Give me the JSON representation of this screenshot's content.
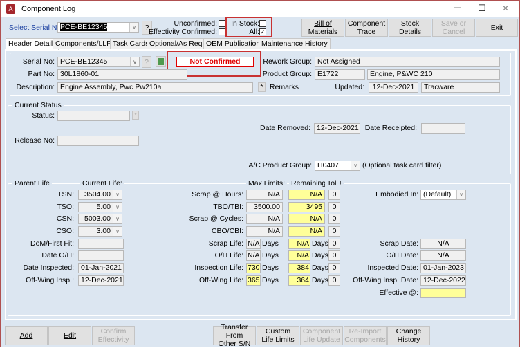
{
  "window": {
    "title": "Component Log",
    "minimize": "—",
    "maximize": "☐",
    "close": "✕"
  },
  "toolbar": {
    "select_serial_label": "Select Serial No:",
    "select_serial_value": "PCE-BE12345",
    "help": "?",
    "unconfirmed_label": "Unconfirmed:",
    "unconfirmed_checked": false,
    "effectivity_label": "Effectivity Confirmed:",
    "effectivity_checked": false,
    "in_stock_label": "In Stock:",
    "in_stock_checked": false,
    "all_label": "All:",
    "all_checked": true,
    "all_mark": "✓",
    "buttons": [
      {
        "l1": "Bill of",
        "l2": "Materials",
        "enabled": true
      },
      {
        "l1": "Component",
        "l2": "Trace",
        "enabled": true
      },
      {
        "l1": "Stock",
        "l2": "Details",
        "enabled": true
      },
      {
        "l1": "Save or",
        "l2": "Cancel",
        "enabled": false
      },
      {
        "l1": "Exit",
        "l2": "",
        "enabled": true
      }
    ]
  },
  "tabs": [
    "Header Details",
    "Components/LLP's",
    "Task Cards",
    "Optional/As Req'd",
    "OEM Publications",
    "Maintenance History"
  ],
  "header": {
    "serial_label": "Serial No:",
    "serial_value": "PCE-BE12345",
    "help": "?",
    "status_badge": "Not Confirmed",
    "part_label": "Part No:",
    "part_value": "30L1860-01",
    "desc_label": "Description:",
    "desc_value": "Engine Assembly, Pwc Pw210a",
    "remarks_btn": "*",
    "remarks_label": "Remarks",
    "rework_label": "Rework Group:",
    "rework_value": "Not Assigned",
    "product_label": "Product Group:",
    "product_code": "E1722",
    "product_name": "Engine, P&WC 210",
    "updated_label": "Updated:",
    "updated_date": "12-Dec-2021",
    "updated_by": "Tracware"
  },
  "status": {
    "legend": "Current Status",
    "status_label": "Status:",
    "status_value": "",
    "status_btn": "*",
    "date_removed_label": "Date Removed:",
    "date_removed": "12-Dec-2021",
    "date_receipted_label": "Date Receipted:",
    "date_receipted": "",
    "release_label": "Release No:",
    "release_value": "",
    "ac_group_label": "A/C Product Group:",
    "ac_group_value": "H0407",
    "ac_group_note": "(Optional task card filter)"
  },
  "life": {
    "legend": "Parent Life",
    "current_header": "Current Life:",
    "max_header": "Max Limits:",
    "remaining_header": "Remaining:",
    "tol_header": "Tol ±",
    "days": "Days",
    "current": [
      {
        "label": "TSN:",
        "value": "3504.00"
      },
      {
        "label": "TSO:",
        "value": "5.00"
      },
      {
        "label": "CSN:",
        "value": "5003.00"
      },
      {
        "label": "CSO:",
        "value": "3.00"
      },
      {
        "label": "DoM/First Fit:",
        "value": ""
      },
      {
        "label": "Date O/H:",
        "value": ""
      },
      {
        "label": "Date Inspected:",
        "value": "01-Jan-2021"
      },
      {
        "label": "Off-Wing Insp.:",
        "value": "12-Dec-2021"
      }
    ],
    "limits": [
      {
        "label": "Scrap @ Hours:",
        "max": "N/A",
        "remaining": "N/A",
        "tol": "0"
      },
      {
        "label": "TBO/TBI:",
        "max": "3500.00",
        "remaining": "3495",
        "tol": "0"
      },
      {
        "label": "Scrap @ Cycles:",
        "max": "N/A",
        "remaining": "N/A",
        "tol": "0"
      },
      {
        "label": "CBO/CBI:",
        "max": "N/A",
        "remaining": "N/A",
        "tol": "0"
      },
      {
        "label": "Scrap Life:",
        "max": "N/A",
        "remaining": "N/A",
        "tol": "0"
      },
      {
        "label": "O/H Life:",
        "max": "N/A",
        "remaining": "N/A",
        "tol": "0"
      },
      {
        "label": "Inspection Life:",
        "max": "730",
        "remaining": "384",
        "tol": "0"
      },
      {
        "label": "Off-Wing Life:",
        "max": "365",
        "remaining": "364",
        "tol": "0"
      }
    ],
    "embodied_label": "Embodied In:",
    "embodied_value": "(Default)",
    "dates": [
      {
        "label": "Scrap Date:",
        "value": "N/A"
      },
      {
        "label": "O/H Date:",
        "value": "N/A"
      },
      {
        "label": "Inspected Date:",
        "value": "01-Jan-2023"
      },
      {
        "label": "Off-Wing Insp. Date:",
        "value": "12-Dec-2022"
      }
    ],
    "effective_label": "Effective @:",
    "effective_value": ""
  },
  "bottom": [
    {
      "l1": "Add",
      "l2": "",
      "enabled": true
    },
    {
      "l1": "Edit",
      "l2": "",
      "enabled": true
    },
    {
      "l1": "Confirm",
      "l2": "Effectivity",
      "enabled": false
    },
    {
      "l1": "Transfer From",
      "l2": "Other S/N",
      "enabled": true
    },
    {
      "l1": "Custom",
      "l2": "Life Limits",
      "enabled": true
    },
    {
      "l1": "Component",
      "l2": "Life Update",
      "enabled": false
    },
    {
      "l1": "Re-Import",
      "l2": "Components",
      "enabled": false
    },
    {
      "l1": "Change",
      "l2": "History",
      "enabled": true
    }
  ],
  "colors": {
    "background": "#dce6f1",
    "highlight": "#c83232",
    "required": "#ffff99",
    "status_text": "#e00000"
  }
}
